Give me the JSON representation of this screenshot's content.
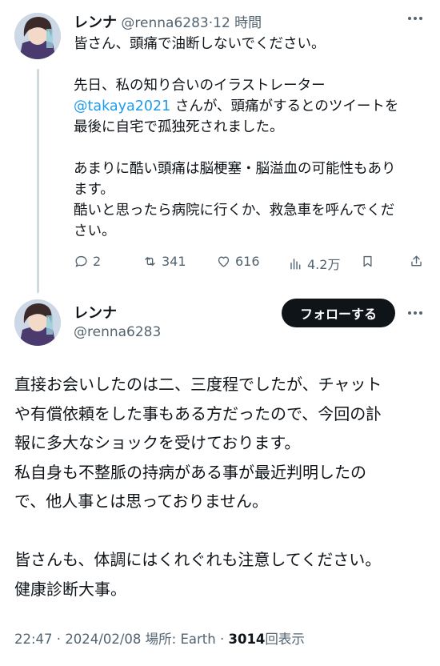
{
  "reply": {
    "author_name": "レンナ",
    "handle": "@renna6283",
    "separator": "·",
    "time": "12 時間",
    "more_icon": "more-horizontal-icon",
    "lines": [
      "皆さん、頭痛で油断しないでください。",
      "",
      "先日、私の知り合いのイラストレーター",
      "さんが、頭痛がするとのツイートを",
      "最後に自宅で孤独死されました。",
      "",
      "あまりに酷い頭痛は脳梗塞・脳溢血の可能性もあり",
      "ます。",
      "酷いと思ったら病院に行くか、救急車を呼んでくだ",
      "さい。"
    ],
    "mention": "@takaya2021",
    "actions": {
      "replies": "2",
      "retweets": "341",
      "likes": "616",
      "views": "4.2万"
    }
  },
  "main": {
    "author_name": "レンナ",
    "handle": "@renna6283",
    "follow_label": "フォローする",
    "lines": [
      "直接お会いしたのは二、三度程でしたが、チャット",
      "や有償依頼をした事もある方だったので、今回の訃",
      "報に多大なショックを受けております。",
      "私自身も不整脈の持病がある事が最近判明したの",
      "で、他人事とは思っておりません。",
      "",
      "皆さんも、体調にはくれぐれも注意してください。",
      "健康診断大事。"
    ],
    "meta": {
      "time": "22:47",
      "date": "2024/02/08",
      "location_label": "場所: Earth",
      "views_count": "3014",
      "views_label": "回表示"
    }
  },
  "colors": {
    "text": "#0f1419",
    "muted": "#536471",
    "link": "#1d9bf0",
    "button_bg": "#0f1419"
  }
}
